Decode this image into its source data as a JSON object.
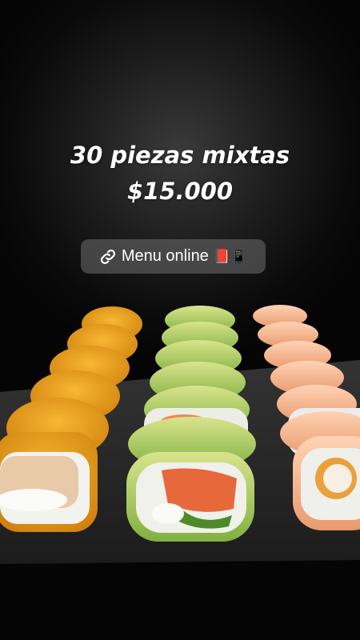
{
  "story": {
    "headline_line1": "30 piezas mixtas",
    "headline_line2": "$15.000"
  },
  "link_sticker": {
    "icon": "link-icon",
    "label": "Menu online",
    "emojis": "📕📱"
  },
  "colors": {
    "background": "#050505",
    "text": "#ffffff",
    "sticker_bg": "#6e6e6e",
    "tempura": "#e8a21c",
    "avocado": "#a9c95a",
    "salmon": "#f4b58f",
    "slate": "#2a2a2a"
  }
}
